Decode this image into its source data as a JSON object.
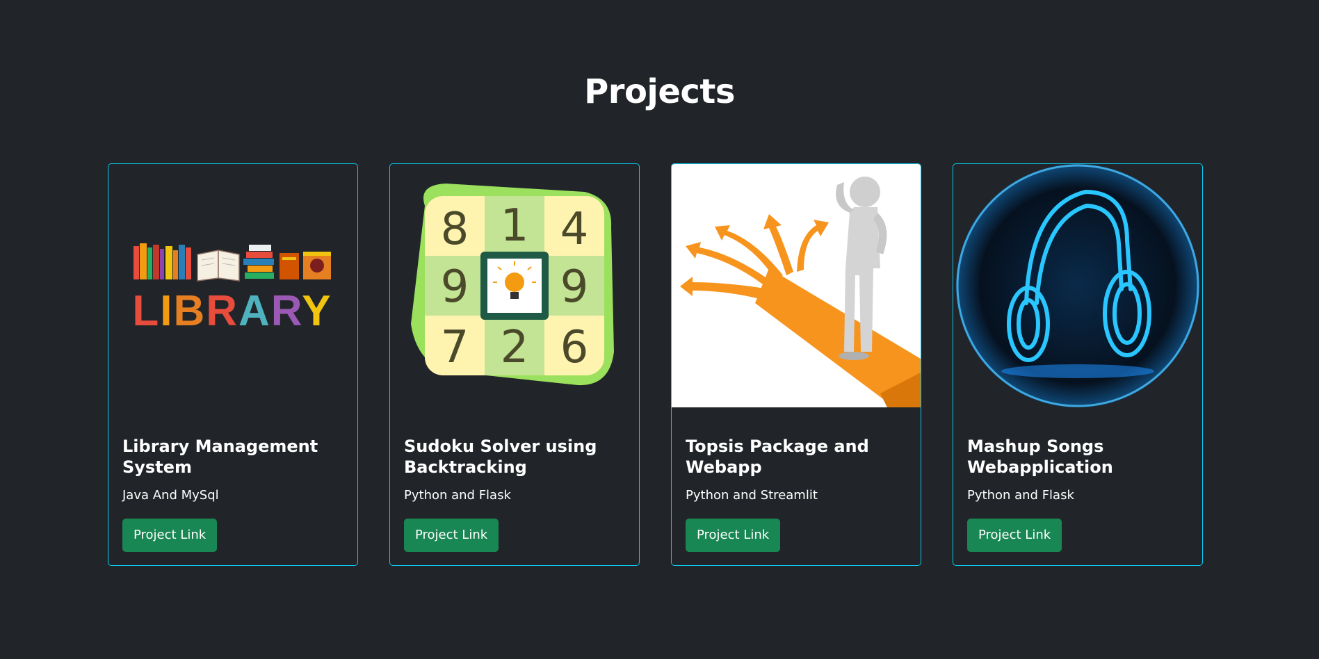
{
  "section": {
    "title": "Projects"
  },
  "projects": [
    {
      "title": "Library Management System",
      "tech": "Java And MySql",
      "button_label": "Project Link",
      "image_text": "LIBRARY",
      "icon": "library-books-image"
    },
    {
      "title": "Sudoku Solver using Backtracking",
      "tech": "Python and Flask",
      "button_label": "Project Link",
      "digits": [
        "8",
        "1",
        "4",
        "9",
        "9",
        "7",
        "2",
        "6"
      ],
      "icon": "sudoku-grid-image"
    },
    {
      "title": "Topsis Package and Webapp",
      "tech": "Python and Streamlit",
      "button_label": "Project Link",
      "icon": "decision-crossroads-image"
    },
    {
      "title": "Mashup Songs Webapplication",
      "tech": "Python and Flask",
      "button_label": "Project Link",
      "icon": "neon-headphones-image"
    }
  ],
  "colors": {
    "background": "#212529",
    "card_border": "#0dcaf0",
    "button": "#198754"
  }
}
